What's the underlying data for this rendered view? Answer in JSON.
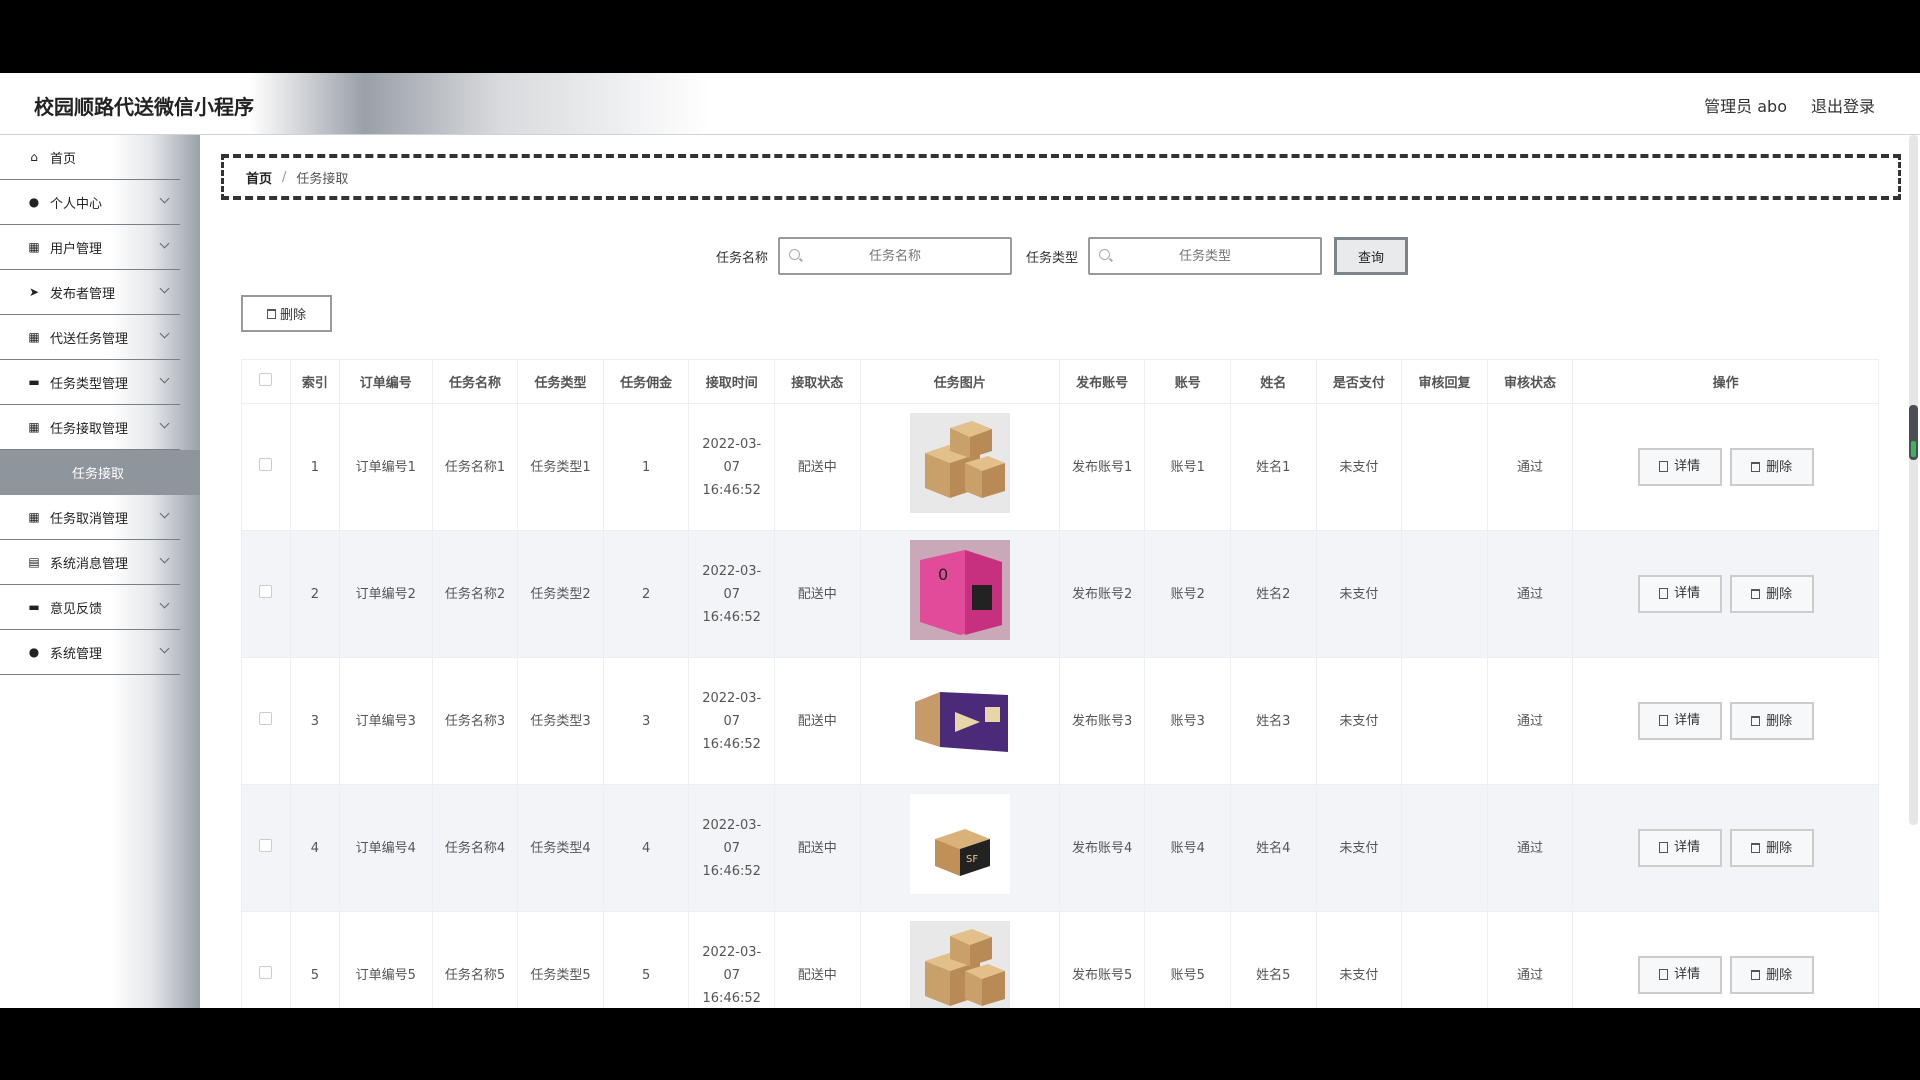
{
  "header": {
    "app_title": "校园顺路代送微信小程序",
    "user": "管理员 abo",
    "logout": "退出登录"
  },
  "sidebar": {
    "items": [
      {
        "label": "首页",
        "icon": "home-icon",
        "glyph": "⌂"
      },
      {
        "label": "个人中心",
        "icon": "person-icon",
        "glyph": "●"
      },
      {
        "label": "用户管理",
        "icon": "grid-icon",
        "glyph": "▦"
      },
      {
        "label": "发布者管理",
        "icon": "send-icon",
        "glyph": "➤"
      },
      {
        "label": "代送任务管理",
        "icon": "grid-icon",
        "glyph": "▦"
      },
      {
        "label": "任务类型管理",
        "icon": "comment-icon",
        "glyph": "▬"
      },
      {
        "label": "任务接取管理",
        "icon": "grid-icon",
        "glyph": "▦"
      },
      {
        "label": "任务接取",
        "icon": "",
        "glyph": ""
      },
      {
        "label": "任务取消管理",
        "icon": "grid-icon",
        "glyph": "▦"
      },
      {
        "label": "系统消息管理",
        "icon": "clipboard-icon",
        "glyph": "▤"
      },
      {
        "label": "意见反馈",
        "icon": "briefcase-icon",
        "glyph": "▬"
      },
      {
        "label": "系统管理",
        "icon": "user-icon",
        "glyph": "●"
      }
    ]
  },
  "breadcrumb": {
    "home": "首页",
    "sep": "/",
    "current": "任务接取"
  },
  "search": {
    "name_label": "任务名称",
    "name_placeholder": "任务名称",
    "type_label": "任务类型",
    "type_placeholder": "任务类型",
    "query_button": "查询"
  },
  "toolbar": {
    "delete_button": "删除"
  },
  "table": {
    "columns": [
      "索引",
      "订单编号",
      "任务名称",
      "任务类型",
      "任务佣金",
      "接取时间",
      "接取状态",
      "任务图片",
      "发布账号",
      "账号",
      "姓名",
      "是否支付",
      "审核回复",
      "审核状态",
      "操作"
    ],
    "rows": [
      {
        "index": "1",
        "order": "订单编号1",
        "name": "任务名称1",
        "type": "任务类型1",
        "fee": "1",
        "time": "2022-03-07 16:46:52",
        "status": "配送中",
        "image": "boxes-stack",
        "publisher": "发布账号1",
        "account": "账号1",
        "person": "姓名1",
        "paid": "未支付",
        "reply": "",
        "audit": "通过"
      },
      {
        "index": "2",
        "order": "订单编号2",
        "name": "任务名称2",
        "type": "任务类型2",
        "fee": "2",
        "time": "2022-03-07 16:46:52",
        "status": "配送中",
        "image": "pink-box",
        "publisher": "发布账号2",
        "account": "账号2",
        "person": "姓名2",
        "paid": "未支付",
        "reply": "",
        "audit": "通过"
      },
      {
        "index": "3",
        "order": "订单编号3",
        "name": "任务名称3",
        "type": "任务类型3",
        "fee": "3",
        "time": "2022-03-07 16:46:52",
        "status": "配送中",
        "image": "purple-box",
        "publisher": "发布账号3",
        "account": "账号3",
        "person": "姓名3",
        "paid": "未支付",
        "reply": "",
        "audit": "通过"
      },
      {
        "index": "4",
        "order": "订单编号4",
        "name": "任务名称4",
        "type": "任务类型4",
        "fee": "4",
        "time": "2022-03-07 16:46:52",
        "status": "配送中",
        "image": "sf-box",
        "publisher": "发布账号4",
        "account": "账号4",
        "person": "姓名4",
        "paid": "未支付",
        "reply": "",
        "audit": "通过"
      },
      {
        "index": "5",
        "order": "订单编号5",
        "name": "任务名称5",
        "type": "任务类型5",
        "fee": "5",
        "time": "2022-03-07 16:46:52",
        "status": "配送中",
        "image": "boxes-stack",
        "publisher": "发布账号5",
        "account": "账号5",
        "person": "姓名5",
        "paid": "未支付",
        "reply": "",
        "audit": "通过"
      }
    ],
    "detail_button": "详情",
    "delete_button": "删除"
  }
}
